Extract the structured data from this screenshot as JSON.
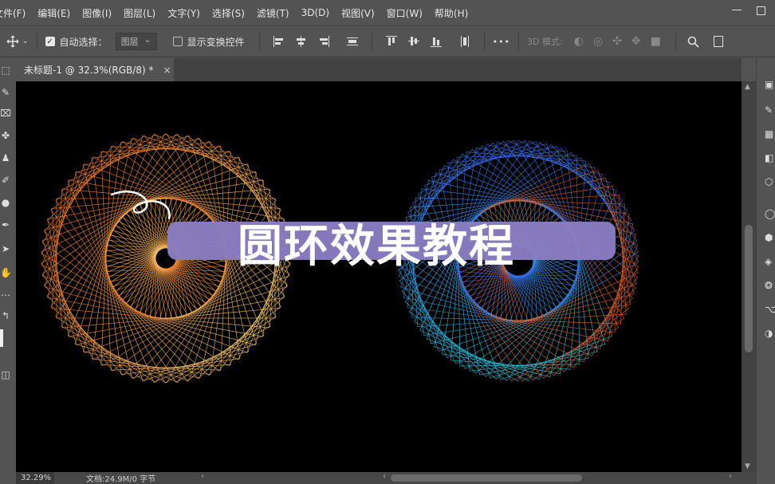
{
  "menubar": {
    "items": [
      "文件(F)",
      "编辑(E)",
      "图像(I)",
      "图层(L)",
      "文字(Y)",
      "选择(S)",
      "滤镜(T)",
      "3D(D)",
      "视图(V)",
      "窗口(W)",
      "帮助(H)"
    ]
  },
  "options": {
    "auto_select_label": "自动选择：",
    "auto_select_value": "图层",
    "show_transform_label": "显示变换控件",
    "mode3d_label": "3D 模式:",
    "more_label": "•••"
  },
  "document": {
    "tab_title": "未标题-1 @ 32.3%(RGB/8) *",
    "close": "×"
  },
  "canvas": {
    "title_text": "圆环效果教程",
    "banner_color": "#8a7dc1",
    "ring_left_colors": [
      "#f5c86a",
      "#f07a2a"
    ],
    "ring_right_colors": [
      "#3a6df0",
      "#2ec6d8",
      "#e0602a"
    ]
  },
  "status": {
    "zoom": "32.29%",
    "doc_size": "文档:24.9M/0 字节"
  },
  "icons": {
    "move": "move-icon",
    "search": "search-icon"
  }
}
